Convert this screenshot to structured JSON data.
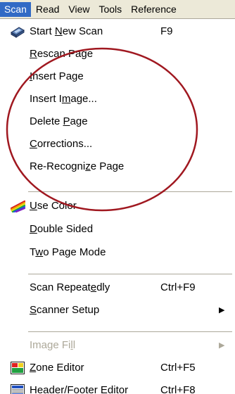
{
  "menubar": {
    "items": [
      {
        "label": "Scan",
        "active": true
      },
      {
        "label": "Read"
      },
      {
        "label": "View"
      },
      {
        "label": "Tools"
      },
      {
        "label": "Reference"
      }
    ]
  },
  "menu": {
    "items": [
      {
        "pre": "Start ",
        "acc": "N",
        "post": "ew Scan",
        "shortcut": "F9",
        "icon": "scanner-icon"
      },
      {
        "pre": "",
        "acc": "R",
        "post": "escan Page"
      },
      {
        "pre": "",
        "acc": "I",
        "post": "nsert Page"
      },
      {
        "pre": "Insert I",
        "acc": "m",
        "post": "age..."
      },
      {
        "pre": "Delete ",
        "acc": "P",
        "post": "age"
      },
      {
        "pre": "",
        "acc": "C",
        "post": "orrections..."
      },
      {
        "pre": "Re-Recogni",
        "acc": "z",
        "post": "e Page"
      },
      {
        "pre": "",
        "acc": "U",
        "post": "se Color",
        "icon": "color-brush-icon"
      },
      {
        "pre": "",
        "acc": "D",
        "post": "ouble Sided"
      },
      {
        "pre": "T",
        "acc": "w",
        "post": "o Page Mode"
      },
      {
        "pre": "Scan Repeat",
        "acc": "e",
        "post": "dly",
        "shortcut": "Ctrl+F9"
      },
      {
        "pre": "",
        "acc": "S",
        "post": "canner Setup",
        "submenu": true
      },
      {
        "pre": "Image Fi",
        "acc": "l",
        "post": "l",
        "disabled": true,
        "submenu": true
      },
      {
        "pre": "",
        "acc": "Z",
        "post": "one Editor",
        "shortcut": "Ctrl+F5",
        "icon": "zone-editor-icon"
      },
      {
        "pre": "Header/",
        "acc": "F",
        "post": "ooter Editor",
        "shortcut": "Ctrl+F8",
        "icon": "header-footer-editor-icon"
      }
    ],
    "submenu_arrow": "▶"
  },
  "colors": {
    "menubar_bg": "#ece9d8",
    "highlight": "#316ac5",
    "annotation_circle": "#a01820",
    "disabled_text": "#aca899"
  }
}
